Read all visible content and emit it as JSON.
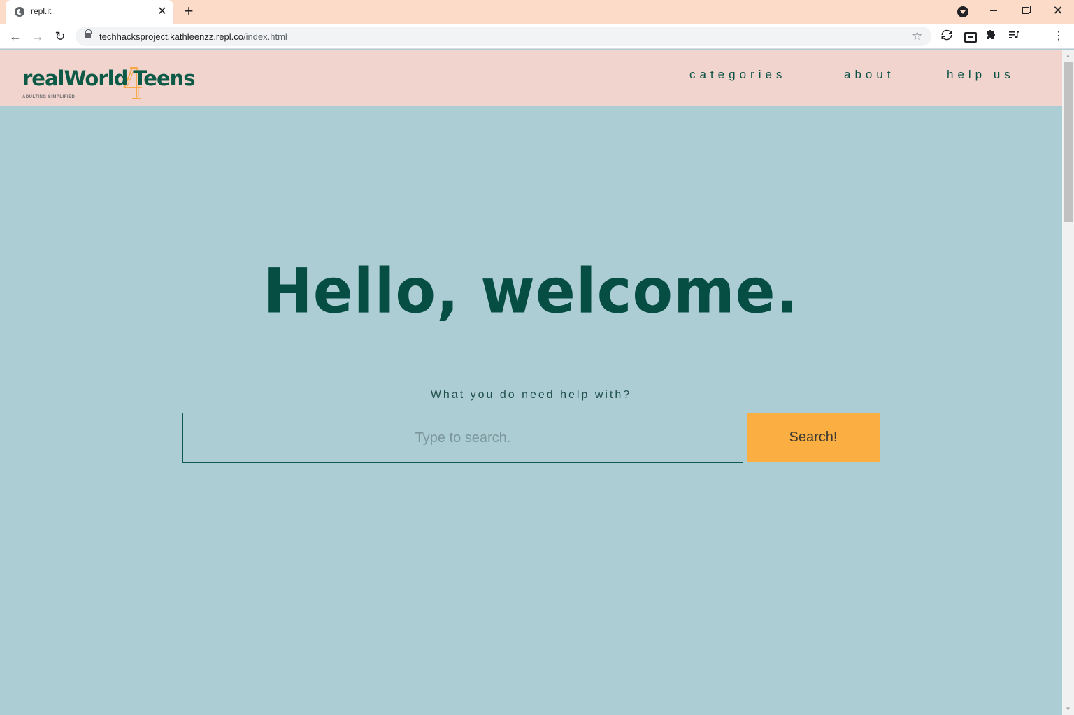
{
  "browser": {
    "tab": {
      "title": "repl.it",
      "close": "✕"
    },
    "new_tab": "+",
    "window": {
      "minimize": "",
      "maximize": "",
      "close": "✕"
    },
    "nav": {
      "back": "←",
      "forward": "→",
      "reload": "↻"
    },
    "url": {
      "host": "techhacksproject.kathleenzz.repl.co",
      "path": "/index.html"
    },
    "toolbar_icons": [
      "sync-icon",
      "picture-in-picture-icon",
      "extensions-icon",
      "media-queue-icon",
      "menu-icon"
    ],
    "star": "☆",
    "menu": "⋮"
  },
  "site": {
    "logo": {
      "text_prefix": "realWorld",
      "number": "4",
      "text_suffix": "Teens",
      "tagline": "ADULTING SIMPLIFIED",
      "colors": {
        "text": "#0d5a47",
        "accent": "#f6a84a"
      }
    },
    "nav": {
      "categories": "categories",
      "about": "about",
      "help_us": "help us"
    },
    "hero": {
      "title": "Hello, welcome.",
      "prompt": "What you do need help with?"
    },
    "search": {
      "placeholder": "Type to search.",
      "value": "",
      "button_label": "Search!"
    },
    "colors": {
      "header_bg": "#f2d4cf",
      "page_bg": "#accdd4",
      "title": "#064d43",
      "button_bg": "#fbae42"
    }
  }
}
